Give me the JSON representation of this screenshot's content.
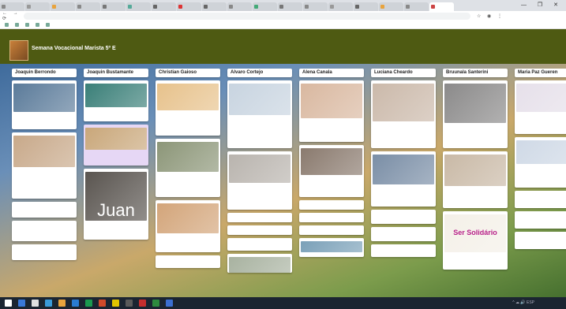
{
  "browser": {
    "tabs": [
      {
        "label": "",
        "color": "#888"
      },
      {
        "label": "",
        "color": "#999"
      },
      {
        "label": "",
        "color": "#e8a33d"
      },
      {
        "label": "",
        "color": "#888"
      },
      {
        "label": "",
        "color": "#777"
      },
      {
        "label": "",
        "color": "#5a9"
      },
      {
        "label": "",
        "color": "#666"
      },
      {
        "label": "",
        "color": "#d33"
      },
      {
        "label": "",
        "color": "#666"
      },
      {
        "label": "",
        "color": "#888"
      },
      {
        "label": "",
        "color": "#4a7"
      },
      {
        "label": "",
        "color": "#777"
      },
      {
        "label": "",
        "color": "#888"
      },
      {
        "label": "",
        "color": "#999"
      },
      {
        "label": "",
        "color": "#666"
      },
      {
        "label": "",
        "color": "#e8a33d"
      },
      {
        "label": "",
        "color": "#888"
      },
      {
        "label": "",
        "color": "#c44"
      }
    ],
    "window_controls": "— ❐ ✕",
    "nav_icons": "← → ⟳",
    "url": "",
    "extensions": "☆ ◉ ⋮",
    "bookmarks": [
      "",
      "",
      "",
      "",
      ""
    ],
    "reading_list": ""
  },
  "board": {
    "author": "",
    "title": "Semana Vocacional Marista 5º E",
    "subtitle": "",
    "actions": [
      "",
      "",
      "",
      ""
    ]
  },
  "columns": [
    {
      "title": "Joaquin Berrondo",
      "cards": [
        {
          "title": "",
          "img_color": "#5b7b9a",
          "img_h": 36,
          "text": "",
          "h": 62
        },
        {
          "title": "",
          "img_color": "#c8a98a",
          "img_h": 40,
          "text": "",
          "h": 84
        },
        {
          "title": "",
          "img_color": "",
          "img_h": 0,
          "text": "",
          "h": 20
        },
        {
          "title": "",
          "img_color": "",
          "img_h": 0,
          "text": "",
          "h": 26
        },
        {
          "title": "",
          "img_color": "",
          "img_h": 0,
          "text": "",
          "h": 20
        }
      ]
    },
    {
      "title": "Joaquin Bustamante",
      "cards": [
        {
          "title": "",
          "img_color": "#3a7f78",
          "img_h": 30,
          "text": "",
          "h": 52
        },
        {
          "title": "",
          "img_color": "#c9a77a",
          "img_h": 28,
          "text": "",
          "h": 52,
          "lav": true
        },
        {
          "title": "",
          "img_color": "#5a5550",
          "img_h": 62,
          "text": "",
          "h": 90,
          "juan": "Juan"
        }
      ]
    },
    {
      "title": "Christian Gaioso",
      "cards": [
        {
          "title": "",
          "img_color": "#e7c28c",
          "img_h": 34,
          "text": "",
          "h": 70
        },
        {
          "title": "",
          "img_color": "#8c9678",
          "img_h": 38,
          "text": "",
          "h": 74
        },
        {
          "title": "",
          "img_color": "#d3a57a",
          "img_h": 38,
          "text": "",
          "h": 66
        },
        {
          "title": "",
          "img_color": "",
          "img_h": 0,
          "text": "",
          "h": 16
        }
      ]
    },
    {
      "title": "Alvaro Cortejo",
      "cards": [
        {
          "title": "",
          "img_color": "#c8d4e0",
          "img_h": 40,
          "text": "",
          "h": 86
        },
        {
          "title": "",
          "img_color": "#b9b4ae",
          "img_h": 36,
          "text": "",
          "h": 74
        },
        {
          "title": "",
          "img_color": "",
          "img_h": 0,
          "text": "",
          "h": 12
        },
        {
          "title": "",
          "img_color": "",
          "img_h": 0,
          "text": "",
          "h": 12
        },
        {
          "title": "",
          "img_color": "",
          "img_h": 0,
          "text": "",
          "h": 16
        },
        {
          "title": "",
          "img_color": "#a8b2a0",
          "img_h": 20,
          "text": "",
          "h": 24
        }
      ]
    },
    {
      "title": "Alena Canala",
      "cards": [
        {
          "title": "",
          "img_color": "#d9b8a0",
          "img_h": 44,
          "text": "",
          "h": 78
        },
        {
          "title": "",
          "img_color": "#8a7a6e",
          "img_h": 34,
          "text": "",
          "h": 66
        },
        {
          "title": "",
          "img_color": "",
          "img_h": 0,
          "text": "",
          "h": 12
        },
        {
          "title": "",
          "img_color": "",
          "img_h": 0,
          "text": "",
          "h": 12
        },
        {
          "title": "",
          "img_color": "",
          "img_h": 0,
          "text": "",
          "h": 12
        },
        {
          "title": "",
          "img_color": "#7aa0b8",
          "img_h": 14,
          "text": "",
          "h": 24
        }
      ]
    },
    {
      "title": "Luciana Cheardo",
      "cards": [
        {
          "title": "",
          "img_color": "#cbb9aa",
          "img_h": 48,
          "text": "",
          "h": 86
        },
        {
          "title": "",
          "img_color": "#7a8ea6",
          "img_h": 38,
          "text": "",
          "h": 70
        },
        {
          "title": "",
          "img_color": "",
          "img_h": 0,
          "text": "",
          "h": 18
        },
        {
          "title": "",
          "img_color": "",
          "img_h": 0,
          "text": "",
          "h": 18
        },
        {
          "title": "",
          "img_color": "",
          "img_h": 0,
          "text": "",
          "h": 16
        }
      ]
    },
    {
      "title": "Bruunala Santerini",
      "cards": [
        {
          "title": "",
          "img_color": "#8b8a8a",
          "img_h": 50,
          "text": "",
          "h": 86
        },
        {
          "title": "",
          "img_color": "#c9b9a6",
          "img_h": 40,
          "text": "",
          "h": 72
        },
        {
          "title": "",
          "img_color": "#f4f0e8",
          "img_h": 48,
          "text": "",
          "h": 74,
          "logo": "Ser Solidário"
        }
      ]
    },
    {
      "title": "Maria Paz Gueren",
      "cards": [
        {
          "title": "",
          "img_color": "#e6e0ea",
          "img_h": 36,
          "text": "",
          "h": 68
        },
        {
          "title": "",
          "img_color": "#cfd9e6",
          "img_h": 30,
          "text": "",
          "h": 64
        },
        {
          "title": "",
          "img_color": "",
          "img_h": 0,
          "text": "",
          "h": 22
        },
        {
          "title": "",
          "img_color": "",
          "img_h": 0,
          "text": "",
          "h": 22
        },
        {
          "title": "",
          "img_color": "",
          "img_h": 0,
          "text": "",
          "h": 22
        }
      ]
    }
  ],
  "taskbar": {
    "icons": [
      "#3a78d8",
      "#e0e0e0",
      "#3a9ad9",
      "#e8a33d",
      "#2b7cd3",
      "#1b9a4f",
      "#d04a2a",
      "#e2c400",
      "#5a5a5a",
      "#c62e2e",
      "#2d8a3e",
      "#3c6fd1"
    ],
    "system": "^ ☁ 🔊 ESP",
    "time": "",
    "date": ""
  }
}
